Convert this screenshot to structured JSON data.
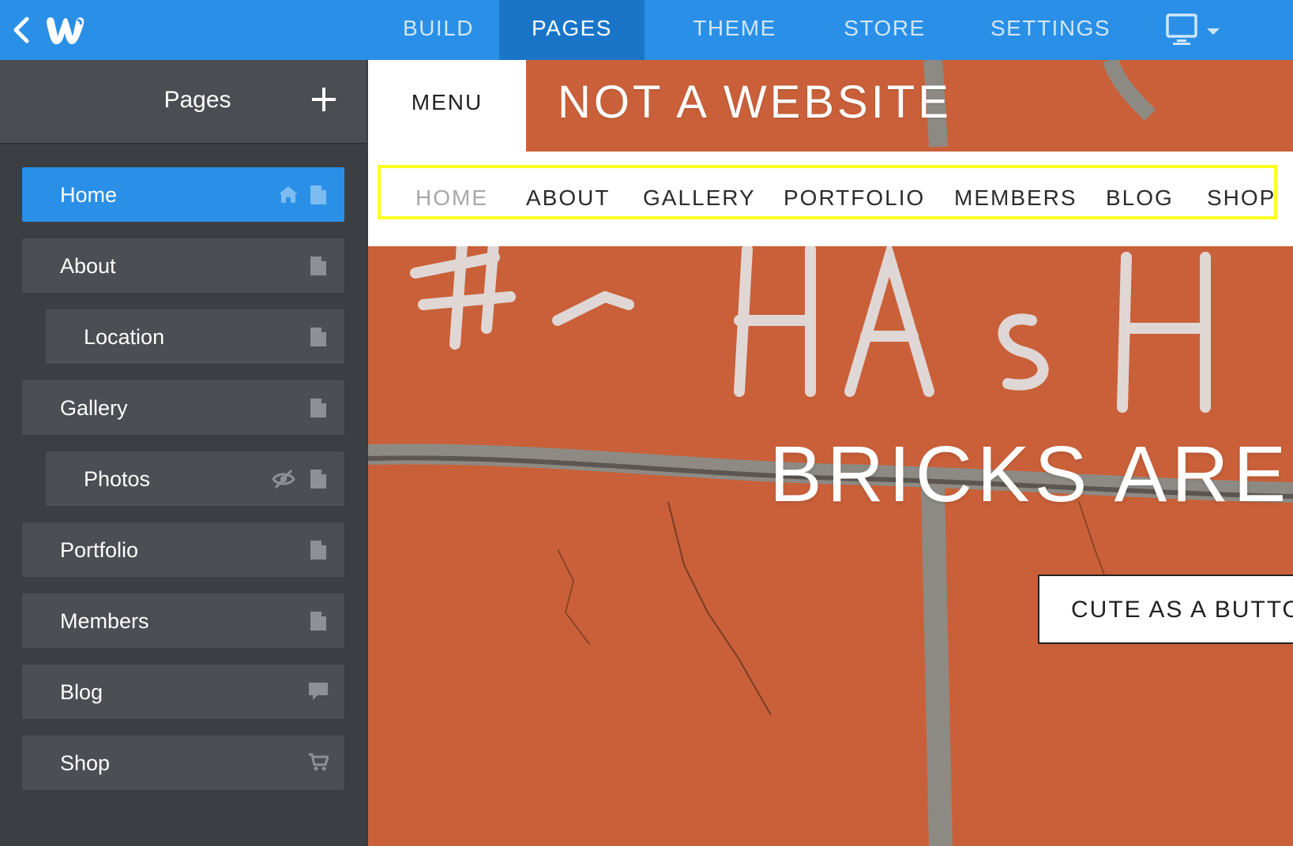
{
  "topbar": {
    "tabs": [
      {
        "label": "BUILD"
      },
      {
        "label": "PAGES"
      },
      {
        "label": "THEME"
      },
      {
        "label": "STORE"
      },
      {
        "label": "SETTINGS"
      }
    ],
    "active_tab": "PAGES",
    "accent_color": "#2a8fe6",
    "active_tab_color": "#1a75c9"
  },
  "sidebar": {
    "title": "Pages",
    "items": [
      {
        "label": "Home",
        "icons": [
          "home-icon",
          "page-icon"
        ],
        "active": true
      },
      {
        "label": "About",
        "icons": [
          "page-icon"
        ]
      },
      {
        "label": "Location",
        "icons": [
          "page-icon"
        ],
        "subpage": true
      },
      {
        "label": "Gallery",
        "icons": [
          "page-icon"
        ]
      },
      {
        "label": "Photos",
        "icons": [
          "hidden-eye-icon",
          "page-icon"
        ],
        "subpage": true
      },
      {
        "label": "Portfolio",
        "icons": [
          "page-icon"
        ]
      },
      {
        "label": "Members",
        "icons": [
          "page-icon"
        ]
      },
      {
        "label": "Blog",
        "icons": [
          "blog-comment-icon"
        ]
      },
      {
        "label": "Shop",
        "icons": [
          "cart-icon"
        ]
      }
    ]
  },
  "site": {
    "menu_label": "MENU",
    "title": "NOT A WEBSITE",
    "nav": [
      "HOME",
      "ABOUT",
      "GALLERY",
      "PORTFOLIO",
      "MEMBERS",
      "BLOG",
      "SHOP"
    ],
    "hero_text": "BRICKS ARE",
    "hero_button": "CUTE AS A BUTTON",
    "brick_color": "#c8603a",
    "highlight_color": "#ffff1e"
  }
}
